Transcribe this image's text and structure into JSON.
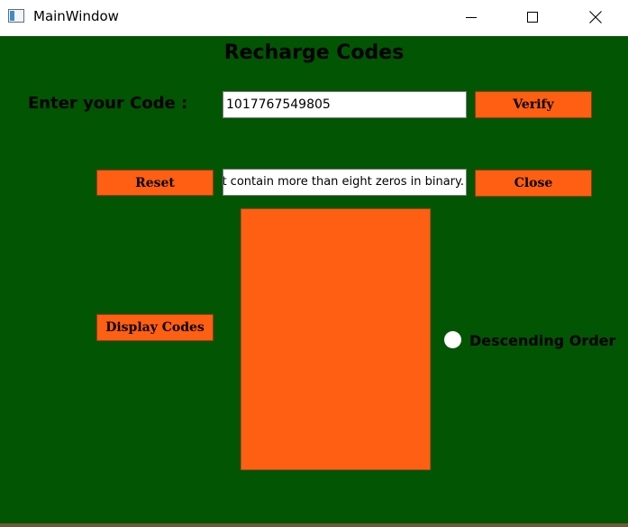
{
  "window": {
    "title": "MainWindow"
  },
  "main": {
    "heading": "Recharge Codes",
    "code_label": "Enter your Code :",
    "code_value": "1017767549805",
    "message": "Codes do not contain more than eight zeros in binary.",
    "buttons": {
      "verify": "Verify",
      "reset": "Reset",
      "close": "Close",
      "display": "Display Codes"
    },
    "sort_option_label": "Descending Order",
    "sort_option_checked": false
  },
  "colors": {
    "background": "#025502",
    "accent": "#ff5f12"
  }
}
